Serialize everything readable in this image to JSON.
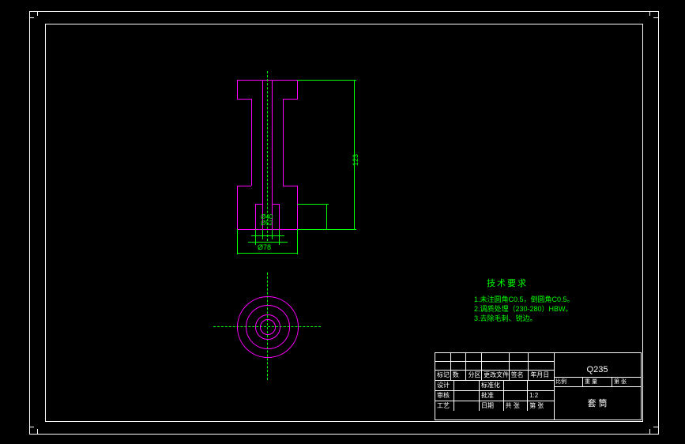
{
  "drawing": {
    "dims": {
      "height": "123",
      "outer_dia": "Ø78",
      "bore1": "Ø40",
      "bore2": "Ø52"
    },
    "tech_req_title": "技术要求",
    "tech_reqs": [
      "1.未注圆角C0.5，倒圆角C0.5。",
      "2.调质处理（230-280）HBW。",
      "3.去除毛刺、锐边。"
    ]
  },
  "titleblock": {
    "material": "Q235",
    "part_name": "套  筒",
    "rows": {
      "r1": [
        "标记",
        "数",
        "分区",
        "更改文件",
        "",
        "签名",
        "年月日",
        "比例",
        "重 量",
        "共 张",
        "第 张"
      ],
      "r2": [
        "设计",
        "",
        "",
        "标准化",
        "",
        "",
        "",
        "",
        ""
      ],
      "r3": [
        "审核",
        "",
        "",
        "批准",
        "",
        "",
        "",
        "",
        "1:2"
      ],
      "r4": [
        "工艺",
        "",
        "",
        "日期",
        "",
        "",
        "共 张",
        "第 张",
        ""
      ]
    }
  }
}
